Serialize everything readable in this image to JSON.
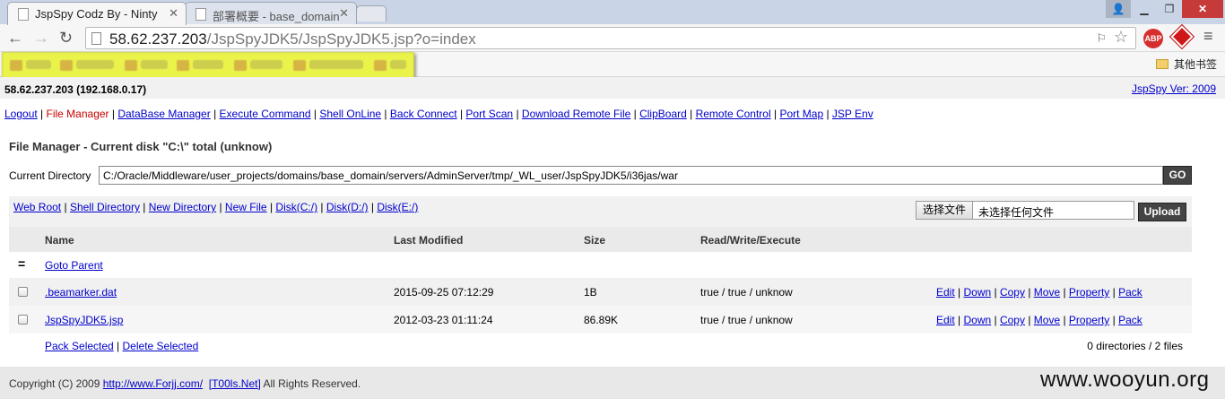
{
  "browser": {
    "tabs": [
      {
        "title": "JspSpy Codz By - Ninty",
        "active": true
      },
      {
        "title": "部署概要 - base_domain",
        "active": false
      }
    ],
    "url_host": "58.62.237.203",
    "url_path": "/JspSpyJDK5/JspSpyJDK5.jsp?o=index",
    "other_bookmarks": "其他书签",
    "abp_label": "ABP"
  },
  "page": {
    "host": "58.62.237.203 (192.168.0.17)",
    "version": "JspSpy Ver: 2009",
    "nav": [
      "Logout",
      "File Manager",
      "DataBase Manager",
      "Execute Command",
      "Shell OnLine",
      "Back Connect",
      "Port Scan",
      "Download Remote File",
      "ClipBoard",
      "Remote Control",
      "Port Map",
      "JSP Env"
    ],
    "fm_title": "File Manager - Current disk \"C:\\\" total (unknow)",
    "current_dir_label": "Current Directory",
    "current_dir": "C:/Oracle/Middleware/user_projects/domains/base_domain/servers/AdminServer/tmp/_WL_user/JspSpyJDK5/i36jas/war",
    "go_label": "GO",
    "quick_links": [
      "Web Root",
      "Shell Directory",
      "New Directory",
      "New File",
      "Disk(C:/)",
      "Disk(D:/)",
      "Disk(E:/)"
    ],
    "file_button": "选择文件",
    "file_none": "未选择任何文件",
    "upload_label": "Upload",
    "columns": {
      "name": "Name",
      "modified": "Last Modified",
      "size": "Size",
      "rwx": "Read/Write/Execute"
    },
    "parent_symbol": "=",
    "goto_parent": "Goto Parent",
    "files": [
      {
        "name": ".beamarker.dat",
        "modified": "2015-09-25 07:12:29",
        "size": "1B",
        "rwx": "true / true / unknow"
      },
      {
        "name": "JspSpyJDK5.jsp",
        "modified": "2012-03-23 01:11:24",
        "size": "86.89K",
        "rwx": "true / true / unknow"
      }
    ],
    "actions": [
      "Edit",
      "Down",
      "Copy",
      "Move",
      "Property",
      "Pack"
    ],
    "pack_selected": "Pack Selected",
    "delete_selected": "Delete Selected",
    "summary": "0 directories / 2 files",
    "copyright_prefix": "Copyright (C) 2009",
    "copyright_link1": "http://www.Forjj.com/",
    "copyright_link2": "[T00ls.Net]",
    "copyright_suffix": "All Rights Reserved.",
    "watermark": "www.wooyun.org"
  }
}
